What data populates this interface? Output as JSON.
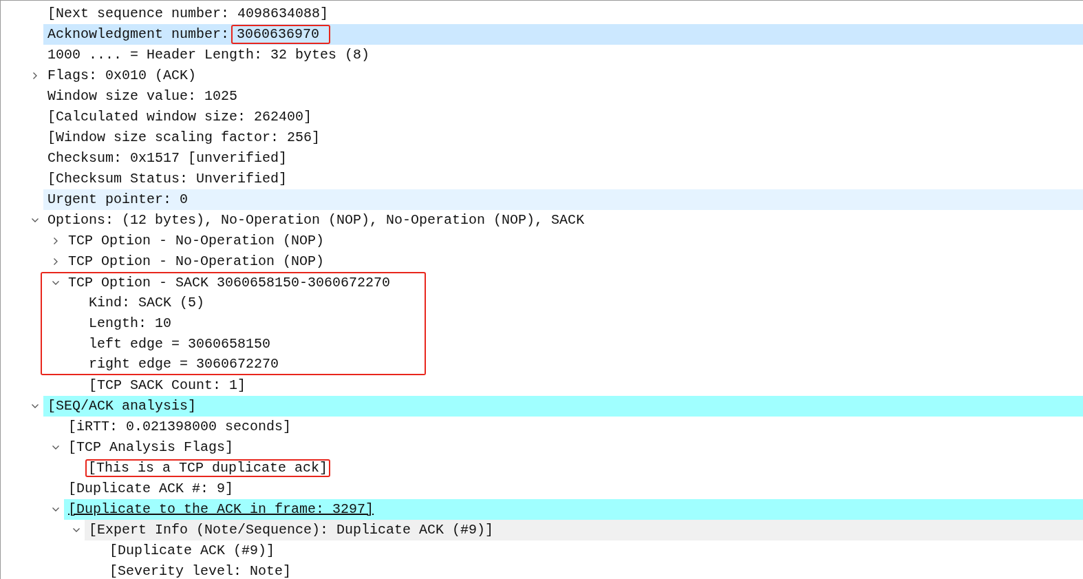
{
  "tree": [
    {
      "text": "[Next sequence number: 4098634088]"
    },
    {
      "text": "Acknowledgment number:",
      "value": "3060636970",
      "value_boxed": true,
      "selected": true
    },
    {
      "text": "1000 .... = Header Length: 32 bytes (8)"
    },
    {
      "text": "Flags: 0x010 (ACK)",
      "expanded": false
    },
    {
      "text": "Window size value: 1025"
    },
    {
      "text": "[Calculated window size: 262400]"
    },
    {
      "text": "[Window size scaling factor: 256]"
    },
    {
      "text": "Checksum: 0x1517 [unverified]"
    },
    {
      "text": "[Checksum Status: Unverified]"
    },
    {
      "text": "Urgent pointer: 0",
      "hovered": true
    },
    {
      "text": "Options: (12 bytes), No-Operation (NOP), No-Operation (NOP), SACK",
      "expanded": true,
      "children": [
        {
          "text": "TCP Option - No-Operation (NOP)",
          "expanded": false
        },
        {
          "text": "TCP Option - No-Operation (NOP)",
          "expanded": false
        },
        {
          "text": "TCP Option - SACK 3060658150-3060672270",
          "expanded": true,
          "in_box": true,
          "children": [
            {
              "text": "Kind: SACK (5)",
              "in_box": true
            },
            {
              "text": "Length: 10",
              "in_box": true
            },
            {
              "text": "left edge = 3060658150",
              "in_box": true
            },
            {
              "text": "right edge = 3060672270",
              "in_box": true
            },
            {
              "text": "[TCP SACK Count: 1]"
            }
          ]
        }
      ]
    },
    {
      "text": "[SEQ/ACK analysis]",
      "expanded": true,
      "color": "#a0ffff",
      "children": [
        {
          "text": "[iRTT: 0.021398000 seconds]"
        },
        {
          "text": "[TCP Analysis Flags]",
          "expanded": true,
          "children": [
            {
              "text": "[This is a TCP duplicate ack]",
              "boxed": true
            }
          ]
        },
        {
          "text": "[Duplicate ACK #: 9]"
        },
        {
          "text": "[Duplicate to the ACK in frame: 3297]",
          "expanded": true,
          "color": "#a0ffff",
          "link": true,
          "children": [
            {
              "text": "[Expert Info (Note/Sequence): Duplicate ACK (#9)]",
              "expanded": true,
              "color": "#f0f0f0",
              "children": [
                {
                  "text": "[Duplicate ACK (#9)]"
                },
                {
                  "text": "[Severity level: Note]"
                }
              ]
            }
          ]
        }
      ]
    }
  ]
}
